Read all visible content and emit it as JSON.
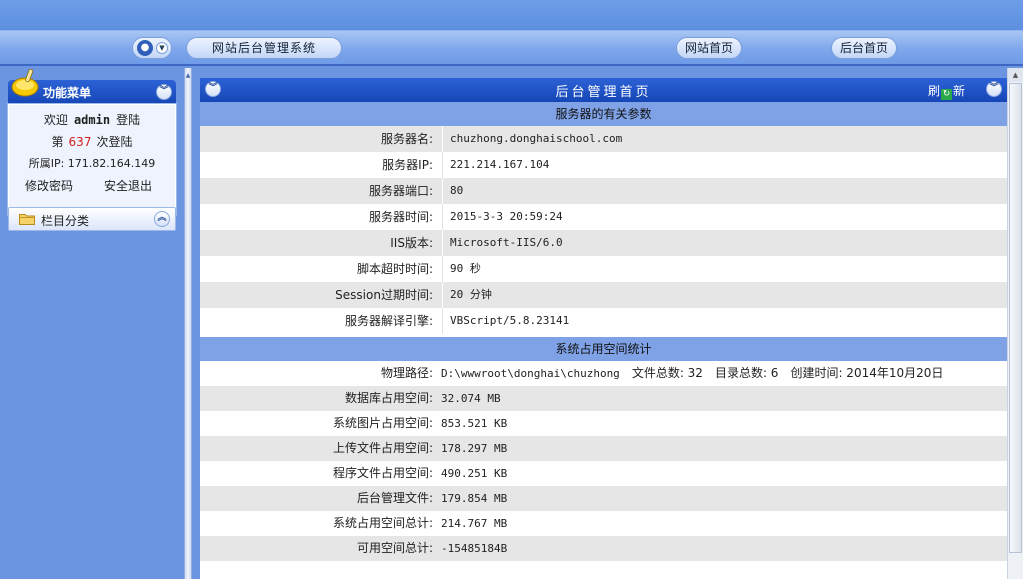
{
  "header": {
    "system_name": "网站后台管理系统",
    "site_home": "网站首页",
    "admin_home": "后台首页"
  },
  "sidebar": {
    "menu_title": "功能菜单",
    "welcome_prefix": "欢迎",
    "username": "admin",
    "welcome_suffix": "登陆",
    "login_prefix": "第",
    "login_count": "637",
    "login_suffix": "次登陆",
    "ip_text": "所属IP: 171.82.164.149",
    "change_password": "修改密码",
    "logout": "安全退出",
    "category_label": "栏目分类"
  },
  "main": {
    "title": "后台管理首页",
    "refresh_left": "刷",
    "refresh_right": "新",
    "server_section": "服务器的有关参数",
    "server_params": [
      {
        "label": "服务器名:",
        "value": "chuzhong.donghaischool.com"
      },
      {
        "label": "服务器IP:",
        "value": "221.214.167.104"
      },
      {
        "label": "服务器端口:",
        "value": "80"
      },
      {
        "label": "服务器时间:",
        "value": "2015-3-3 20:59:24"
      },
      {
        "label": "IIS版本:",
        "value": "Microsoft-IIS/6.0"
      },
      {
        "label": "脚本超时时间:",
        "value": "90 秒"
      },
      {
        "label": "Session过期时间:",
        "value": "20 分钟"
      },
      {
        "label": "服务器解译引擎:",
        "value": "VBScript/5.8.23141"
      }
    ],
    "space_section": "系统占用空间统计",
    "path_label": "物理路径:",
    "path_value": "D:\\wwwroot\\donghai\\chuzhong",
    "file_total": "文件总数: 32",
    "dir_total": "目录总数: 6",
    "created": "创建时间: 2014年10月20日",
    "space_rows": [
      {
        "label": "数据库占用空间:",
        "value": "32.074 MB"
      },
      {
        "label": "系统图片占用空间:",
        "value": "853.521 KB"
      },
      {
        "label": "上传文件占用空间:",
        "value": "178.297 MB"
      },
      {
        "label": "程序文件占用空间:",
        "value": "490.251 KB"
      },
      {
        "label": "后台管理文件:",
        "value": "179.854 MB"
      },
      {
        "label": "系统占用空间总计:",
        "value": "214.767 MB"
      },
      {
        "label": "可用空间总计:",
        "value": "-15485184B"
      }
    ]
  }
}
